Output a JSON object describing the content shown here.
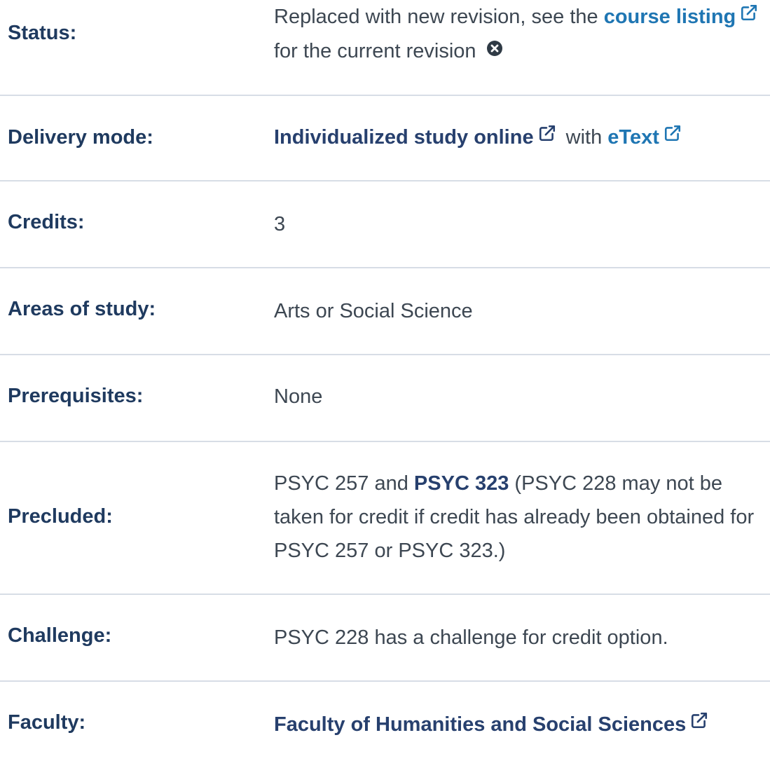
{
  "colors": {
    "label": "#1f3a5f",
    "link_blue": "#1f76b3",
    "link_dark": "#27406e",
    "text": "#3d4752",
    "divider": "#d7dde6"
  },
  "rows": {
    "status": {
      "label": "Status:",
      "prefix": "Replaced with new revision, see the",
      "link": "course listing",
      "suffix": "for the current revision",
      "link_icon": "external-link-icon",
      "end_icon": "times-circle-icon"
    },
    "delivery": {
      "label": "Delivery mode:",
      "link1": "Individualized study online",
      "middle": "with",
      "link2": "eText",
      "link_icon": "external-link-icon"
    },
    "credits": {
      "label": "Credits:",
      "value": "3"
    },
    "areas": {
      "label": "Areas of study:",
      "value": "Arts or Social Science"
    },
    "prerequisites": {
      "label": "Prerequisites:",
      "value": "None"
    },
    "precluded": {
      "label": "Precluded:",
      "part1": "PSYC 257 and",
      "bold": "PSYC 323",
      "part2": "(PSYC 228 may not be taken for credit if credit has already been obtained for PSYC 257 or PSYC 323.)"
    },
    "challenge": {
      "label": "Challenge:",
      "value": "PSYC 228 has a challenge for credit option."
    },
    "faculty": {
      "label": "Faculty:",
      "link": "Faculty of Humanities and Social Sciences",
      "link_icon": "external-link-icon"
    }
  }
}
